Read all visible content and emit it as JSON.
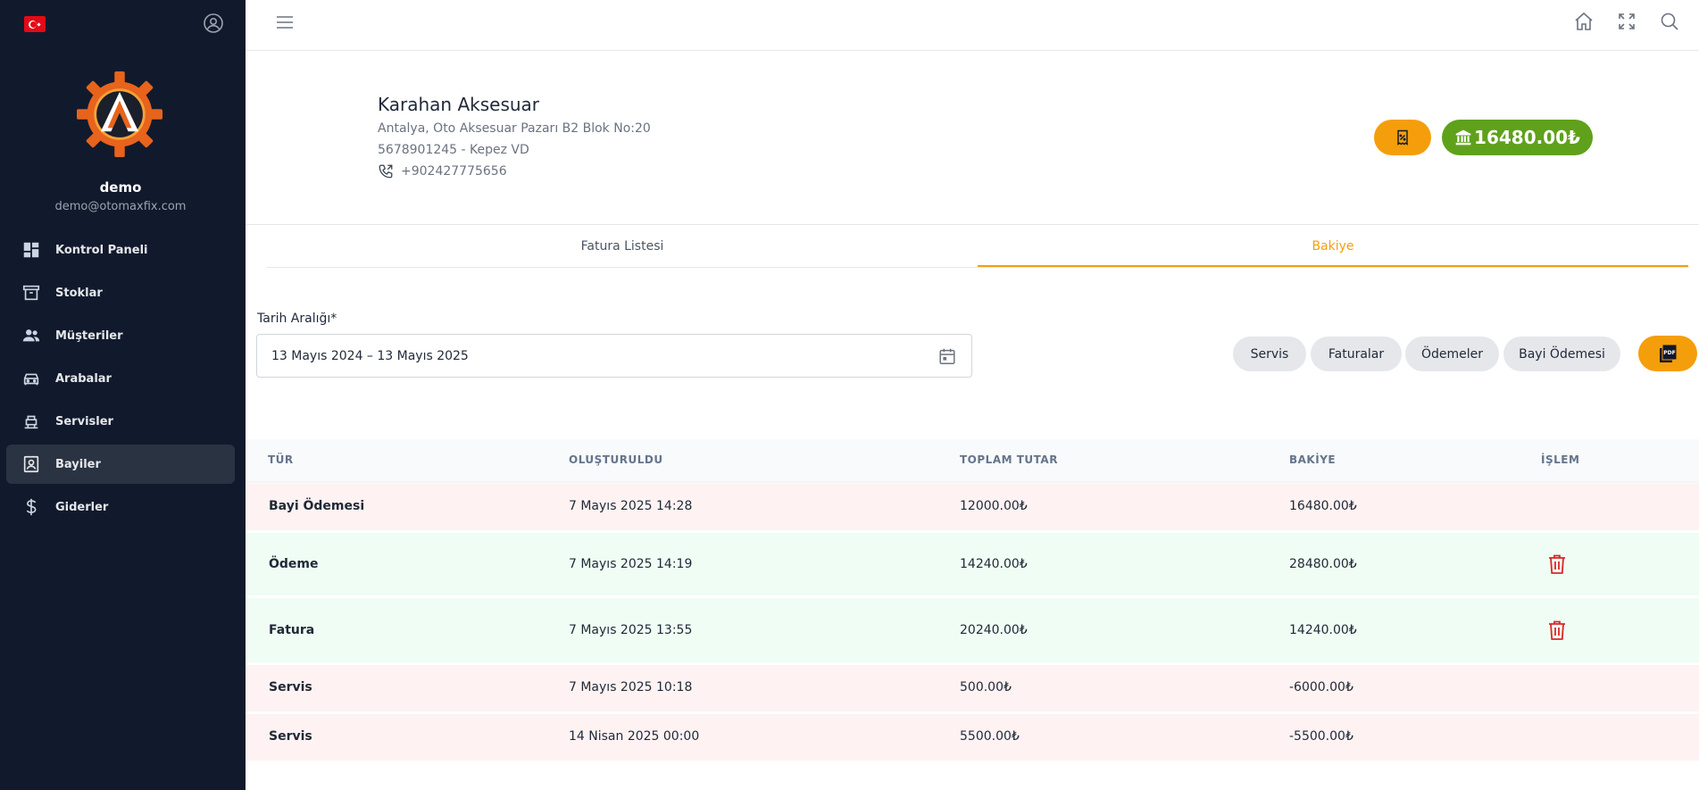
{
  "sidebar": {
    "user": {
      "name": "demo",
      "email": "demo@otomaxfix.com"
    },
    "items": [
      {
        "label": "Kontrol Paneli",
        "icon": "dashboard-icon"
      },
      {
        "label": "Stoklar",
        "icon": "archive-icon"
      },
      {
        "label": "Müşteriler",
        "icon": "users-icon"
      },
      {
        "label": "Arabalar",
        "icon": "car-icon"
      },
      {
        "label": "Servisler",
        "icon": "service-icon"
      },
      {
        "label": "Bayiler",
        "icon": "contact-card-icon",
        "active": true
      },
      {
        "label": "Giderler",
        "icon": "dollar-icon"
      }
    ]
  },
  "dealer": {
    "name": "Karahan Aksesuar",
    "address": "Antalya, Oto Aksesuar Pazarı B2 Blok No:20",
    "tax": "5678901245 - Kepez VD",
    "phone": "+902427775656",
    "balance": "16480.00₺"
  },
  "tabs": [
    {
      "label": "Fatura Listesi",
      "active": false
    },
    {
      "label": "Bakiye",
      "active": true
    }
  ],
  "filters": {
    "date_label": "Tarih Aralığı*",
    "date_value": "13 Mayıs 2024 – 13 Mayıs 2025",
    "chips": [
      "Servis",
      "Faturalar",
      "Ödemeler",
      "Bayi Ödemesi"
    ],
    "pdf_label": "PDF"
  },
  "table": {
    "headers": [
      "TÜR",
      "OLUŞTURULDU",
      "TOPLAM TUTAR",
      "BAKİYE",
      "İŞLEM"
    ],
    "rows": [
      {
        "type": "Bayi Ödemesi",
        "created": "7 Mayıs 2025 14:28",
        "total": "12000.00₺",
        "balance": "16480.00₺",
        "deletable": false,
        "tone": "red"
      },
      {
        "type": "Ödeme",
        "created": "7 Mayıs 2025 14:19",
        "total": "14240.00₺",
        "balance": "28480.00₺",
        "deletable": true,
        "tone": "green"
      },
      {
        "type": "Fatura",
        "created": "7 Mayıs 2025 13:55",
        "total": "20240.00₺",
        "balance": "14240.00₺",
        "deletable": true,
        "tone": "green"
      },
      {
        "type": "Servis",
        "created": "7 Mayıs 2025 10:18",
        "total": "500.00₺",
        "balance": "-6000.00₺",
        "deletable": false,
        "tone": "red"
      },
      {
        "type": "Servis",
        "created": "14 Nisan 2025 00:00",
        "total": "5500.00₺",
        "balance": "-5500.00₺",
        "deletable": false,
        "tone": "red"
      }
    ]
  },
  "colors": {
    "accent": "#f59e0b",
    "balance_green": "#5fa11b",
    "sidebar_bg": "#111a2c",
    "danger": "#dc2626"
  }
}
